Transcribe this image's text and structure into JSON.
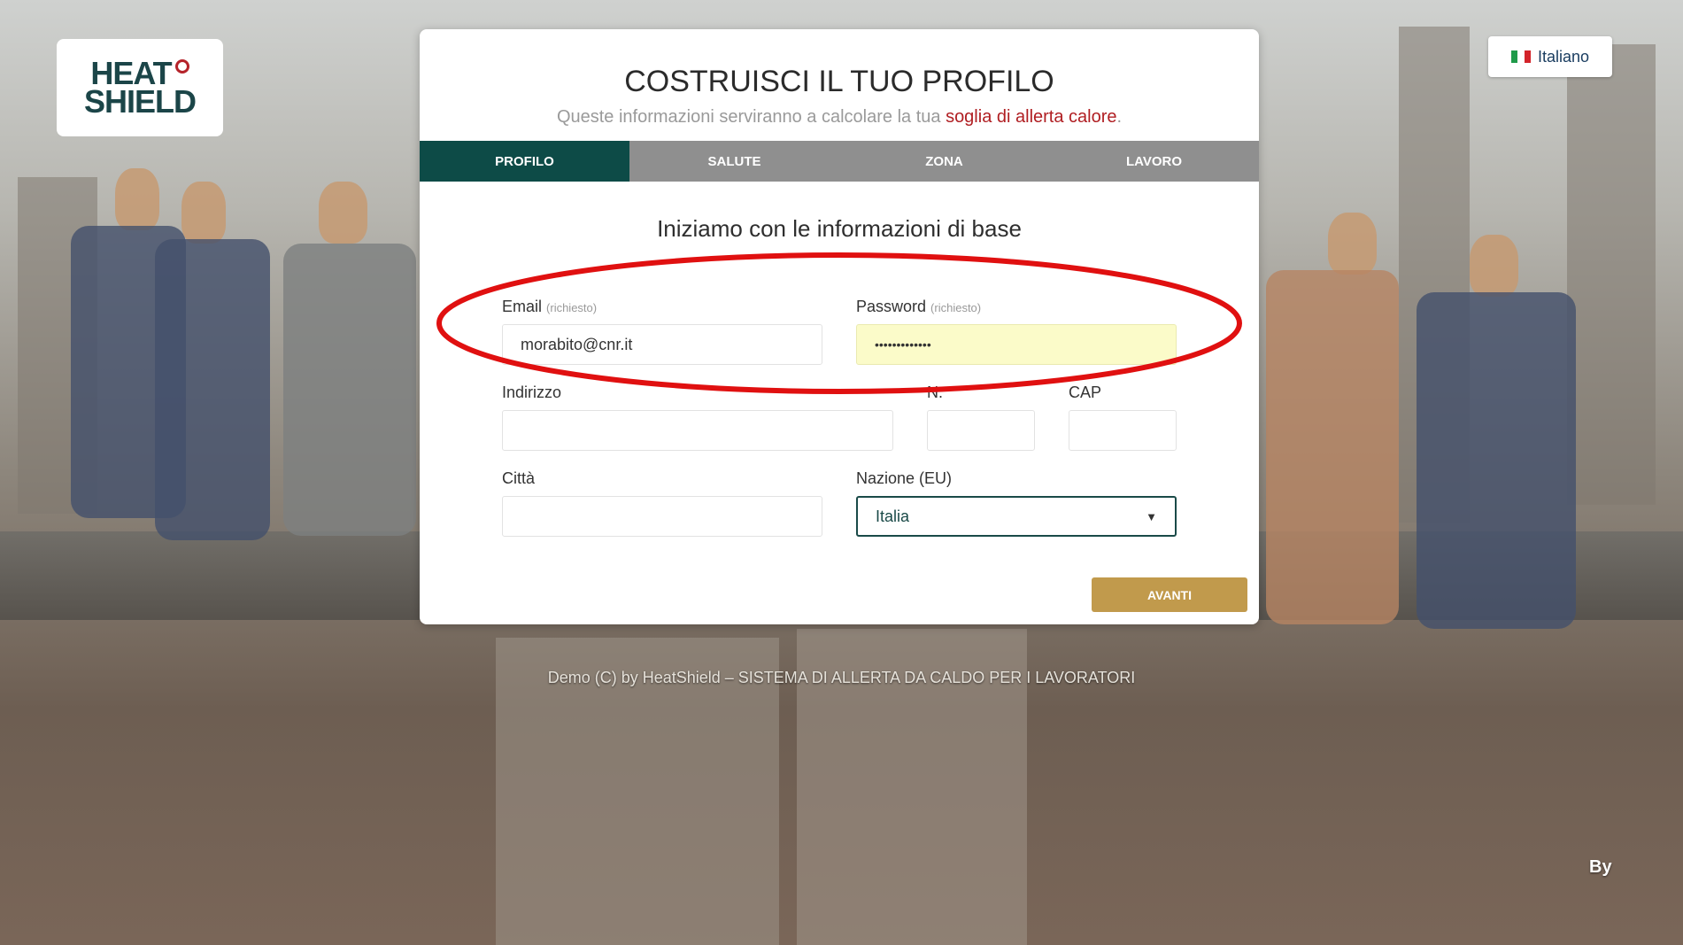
{
  "logo": {
    "line1": "HEAT",
    "line2": "SHIELD"
  },
  "language": {
    "label": "Italiano"
  },
  "header": {
    "title": "COSTRUISCI IL TUO PROFILO",
    "subtitle_prefix": "Queste informazioni serviranno a calcolare la tua ",
    "subtitle_highlight": "soglia di allerta calore",
    "subtitle_suffix": "."
  },
  "tabs": [
    {
      "label": "PROFILO",
      "active": true
    },
    {
      "label": "SALUTE",
      "active": false
    },
    {
      "label": "ZONA",
      "active": false
    },
    {
      "label": "LAVORO",
      "active": false
    }
  ],
  "section_title": "Iniziamo con le informazioni di base",
  "form": {
    "email_label": "Email",
    "email_required": "(richiesto)",
    "email_value": "morabito@cnr.it",
    "password_label": "Password",
    "password_required": "(richiesto)",
    "password_value": "•••••••••••••",
    "address_label": "Indirizzo",
    "address_value": "",
    "number_label": "N.",
    "number_value": "",
    "cap_label": "CAP",
    "cap_value": "",
    "city_label": "Città",
    "city_value": "",
    "country_label": "Nazione (EU)",
    "country_value": "Italia"
  },
  "next_button": "AVANTI",
  "footer": "Demo (C) by HeatShield – SISTEMA DI ALLERTA DA CALDO PER I LAVORATORI",
  "by_label": "By",
  "colors": {
    "accent_teal": "#0d4b47",
    "highlight_red": "#b01e22",
    "button_gold": "#c19a4c",
    "annotation_red": "#e01010"
  }
}
